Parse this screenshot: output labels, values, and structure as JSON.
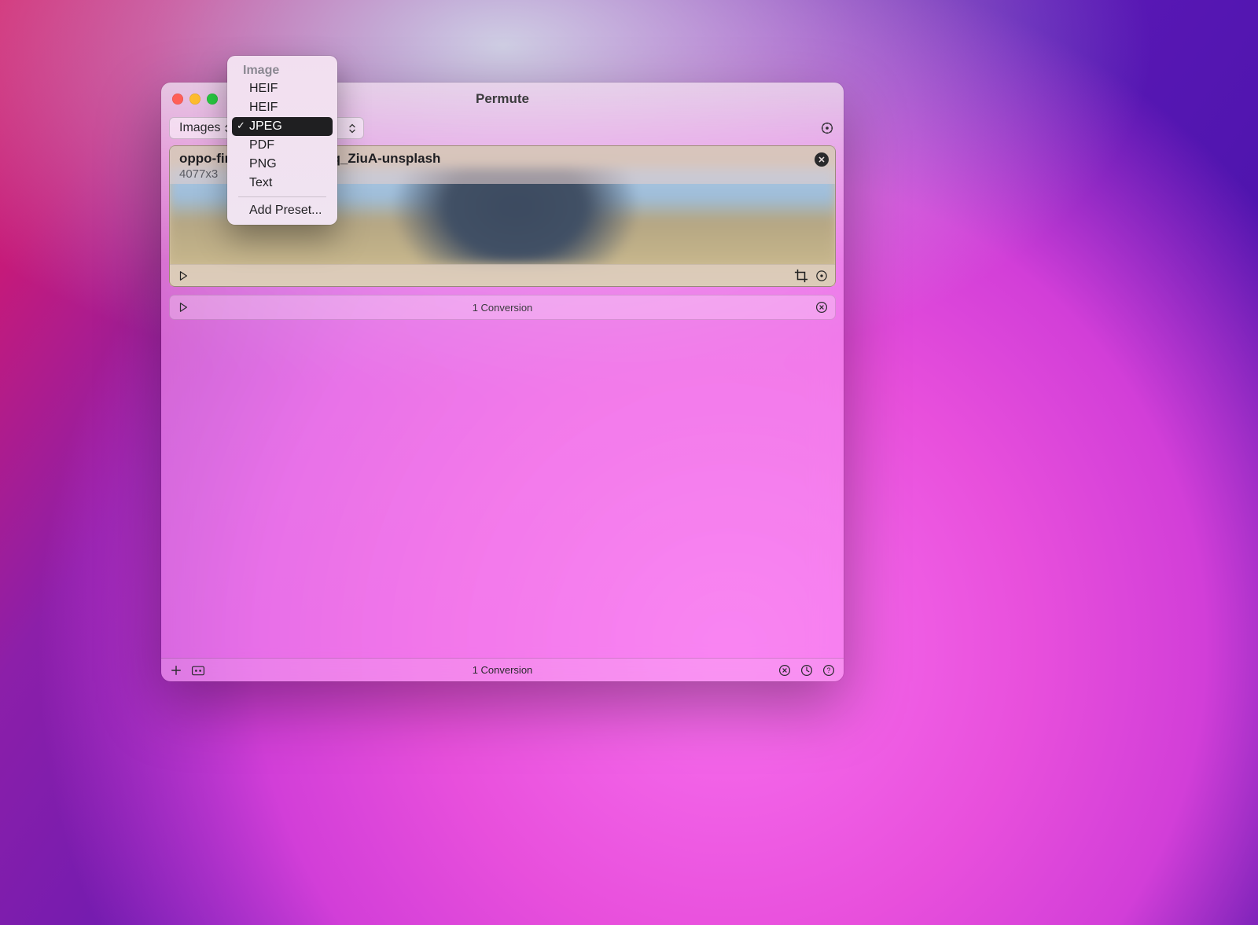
{
  "window": {
    "title": "Permute"
  },
  "toolbar": {
    "category_label": "Images",
    "format_selected": "JPEG"
  },
  "menu": {
    "section": "Image",
    "items": [
      "HEIF",
      "HEIF",
      "JPEG",
      "PDF",
      "PNG",
      "Text"
    ],
    "selected_index": 2,
    "add_preset": "Add Preset..."
  },
  "file": {
    "name": "oppo-find-x5-pro-IF9zLJq_ZiuA-unsplash",
    "dimensions": "4077x3"
  },
  "summary": {
    "text": "1 Conversion"
  },
  "bottombar": {
    "text": "1 Conversion"
  }
}
